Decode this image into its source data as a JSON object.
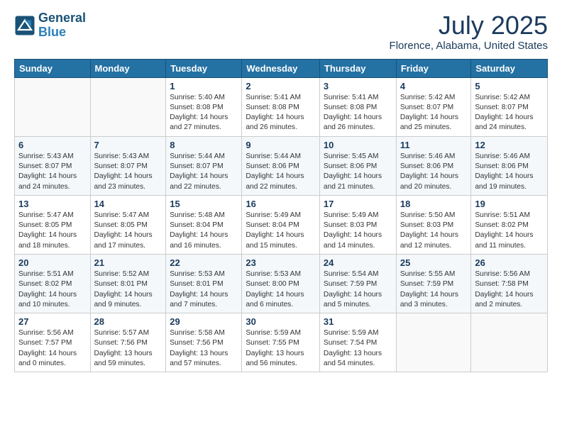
{
  "header": {
    "logo_line1": "General",
    "logo_line2": "Blue",
    "month": "July 2025",
    "location": "Florence, Alabama, United States"
  },
  "weekdays": [
    "Sunday",
    "Monday",
    "Tuesday",
    "Wednesday",
    "Thursday",
    "Friday",
    "Saturday"
  ],
  "weeks": [
    [
      {
        "day": "",
        "detail": ""
      },
      {
        "day": "",
        "detail": ""
      },
      {
        "day": "1",
        "detail": "Sunrise: 5:40 AM\nSunset: 8:08 PM\nDaylight: 14 hours\nand 27 minutes."
      },
      {
        "day": "2",
        "detail": "Sunrise: 5:41 AM\nSunset: 8:08 PM\nDaylight: 14 hours\nand 26 minutes."
      },
      {
        "day": "3",
        "detail": "Sunrise: 5:41 AM\nSunset: 8:08 PM\nDaylight: 14 hours\nand 26 minutes."
      },
      {
        "day": "4",
        "detail": "Sunrise: 5:42 AM\nSunset: 8:07 PM\nDaylight: 14 hours\nand 25 minutes."
      },
      {
        "day": "5",
        "detail": "Sunrise: 5:42 AM\nSunset: 8:07 PM\nDaylight: 14 hours\nand 24 minutes."
      }
    ],
    [
      {
        "day": "6",
        "detail": "Sunrise: 5:43 AM\nSunset: 8:07 PM\nDaylight: 14 hours\nand 24 minutes."
      },
      {
        "day": "7",
        "detail": "Sunrise: 5:43 AM\nSunset: 8:07 PM\nDaylight: 14 hours\nand 23 minutes."
      },
      {
        "day": "8",
        "detail": "Sunrise: 5:44 AM\nSunset: 8:07 PM\nDaylight: 14 hours\nand 22 minutes."
      },
      {
        "day": "9",
        "detail": "Sunrise: 5:44 AM\nSunset: 8:06 PM\nDaylight: 14 hours\nand 22 minutes."
      },
      {
        "day": "10",
        "detail": "Sunrise: 5:45 AM\nSunset: 8:06 PM\nDaylight: 14 hours\nand 21 minutes."
      },
      {
        "day": "11",
        "detail": "Sunrise: 5:46 AM\nSunset: 8:06 PM\nDaylight: 14 hours\nand 20 minutes."
      },
      {
        "day": "12",
        "detail": "Sunrise: 5:46 AM\nSunset: 8:06 PM\nDaylight: 14 hours\nand 19 minutes."
      }
    ],
    [
      {
        "day": "13",
        "detail": "Sunrise: 5:47 AM\nSunset: 8:05 PM\nDaylight: 14 hours\nand 18 minutes."
      },
      {
        "day": "14",
        "detail": "Sunrise: 5:47 AM\nSunset: 8:05 PM\nDaylight: 14 hours\nand 17 minutes."
      },
      {
        "day": "15",
        "detail": "Sunrise: 5:48 AM\nSunset: 8:04 PM\nDaylight: 14 hours\nand 16 minutes."
      },
      {
        "day": "16",
        "detail": "Sunrise: 5:49 AM\nSunset: 8:04 PM\nDaylight: 14 hours\nand 15 minutes."
      },
      {
        "day": "17",
        "detail": "Sunrise: 5:49 AM\nSunset: 8:03 PM\nDaylight: 14 hours\nand 14 minutes."
      },
      {
        "day": "18",
        "detail": "Sunrise: 5:50 AM\nSunset: 8:03 PM\nDaylight: 14 hours\nand 12 minutes."
      },
      {
        "day": "19",
        "detail": "Sunrise: 5:51 AM\nSunset: 8:02 PM\nDaylight: 14 hours\nand 11 minutes."
      }
    ],
    [
      {
        "day": "20",
        "detail": "Sunrise: 5:51 AM\nSunset: 8:02 PM\nDaylight: 14 hours\nand 10 minutes."
      },
      {
        "day": "21",
        "detail": "Sunrise: 5:52 AM\nSunset: 8:01 PM\nDaylight: 14 hours\nand 9 minutes."
      },
      {
        "day": "22",
        "detail": "Sunrise: 5:53 AM\nSunset: 8:01 PM\nDaylight: 14 hours\nand 7 minutes."
      },
      {
        "day": "23",
        "detail": "Sunrise: 5:53 AM\nSunset: 8:00 PM\nDaylight: 14 hours\nand 6 minutes."
      },
      {
        "day": "24",
        "detail": "Sunrise: 5:54 AM\nSunset: 7:59 PM\nDaylight: 14 hours\nand 5 minutes."
      },
      {
        "day": "25",
        "detail": "Sunrise: 5:55 AM\nSunset: 7:59 PM\nDaylight: 14 hours\nand 3 minutes."
      },
      {
        "day": "26",
        "detail": "Sunrise: 5:56 AM\nSunset: 7:58 PM\nDaylight: 14 hours\nand 2 minutes."
      }
    ],
    [
      {
        "day": "27",
        "detail": "Sunrise: 5:56 AM\nSunset: 7:57 PM\nDaylight: 14 hours\nand 0 minutes."
      },
      {
        "day": "28",
        "detail": "Sunrise: 5:57 AM\nSunset: 7:56 PM\nDaylight: 13 hours\nand 59 minutes."
      },
      {
        "day": "29",
        "detail": "Sunrise: 5:58 AM\nSunset: 7:56 PM\nDaylight: 13 hours\nand 57 minutes."
      },
      {
        "day": "30",
        "detail": "Sunrise: 5:59 AM\nSunset: 7:55 PM\nDaylight: 13 hours\nand 56 minutes."
      },
      {
        "day": "31",
        "detail": "Sunrise: 5:59 AM\nSunset: 7:54 PM\nDaylight: 13 hours\nand 54 minutes."
      },
      {
        "day": "",
        "detail": ""
      },
      {
        "day": "",
        "detail": ""
      }
    ]
  ]
}
